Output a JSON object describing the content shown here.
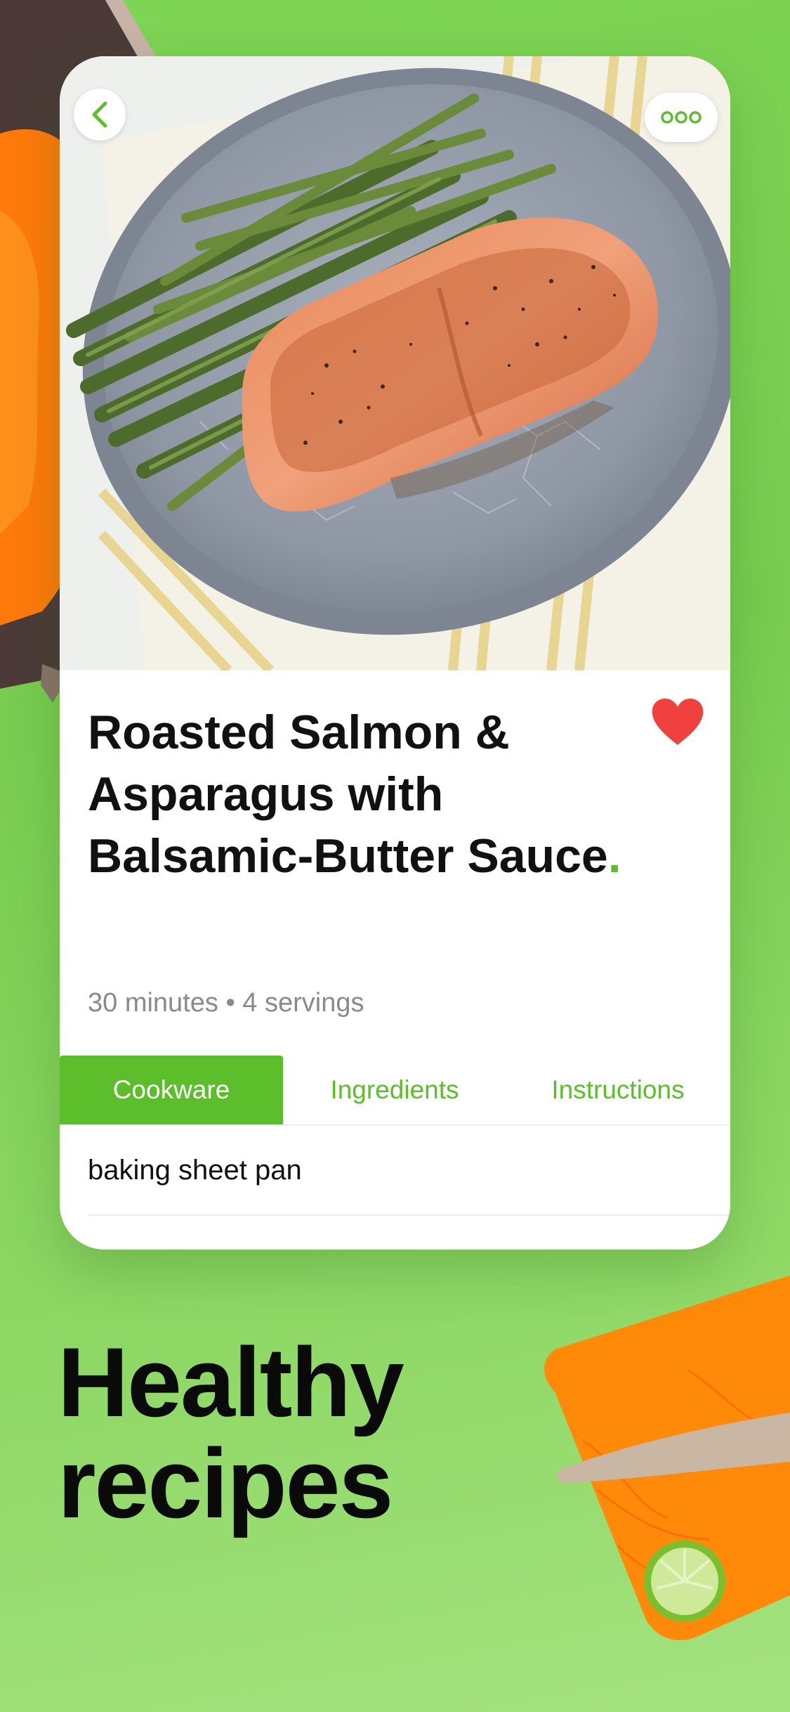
{
  "recipe": {
    "title": "Roasted Salmon & Asparagus with Balsamic-Butter Sauce",
    "title_dot": ".",
    "meta": "30 minutes • 4 servings",
    "favorite": true
  },
  "nav": {
    "back_icon": "chevron-left-icon",
    "more_icon": "more-dots-icon"
  },
  "tabs": [
    {
      "label": "Cookware",
      "active": true
    },
    {
      "label": "Ingredients",
      "active": false
    },
    {
      "label": "Instructions",
      "active": false
    }
  ],
  "cookware_items": [
    "baking sheet pan"
  ],
  "promo": {
    "line1": "Healthy",
    "line2": "recipes"
  },
  "colors": {
    "accent_green": "#5cbe2a",
    "heart_red": "#f0413e",
    "background_green": "#7ed454"
  }
}
